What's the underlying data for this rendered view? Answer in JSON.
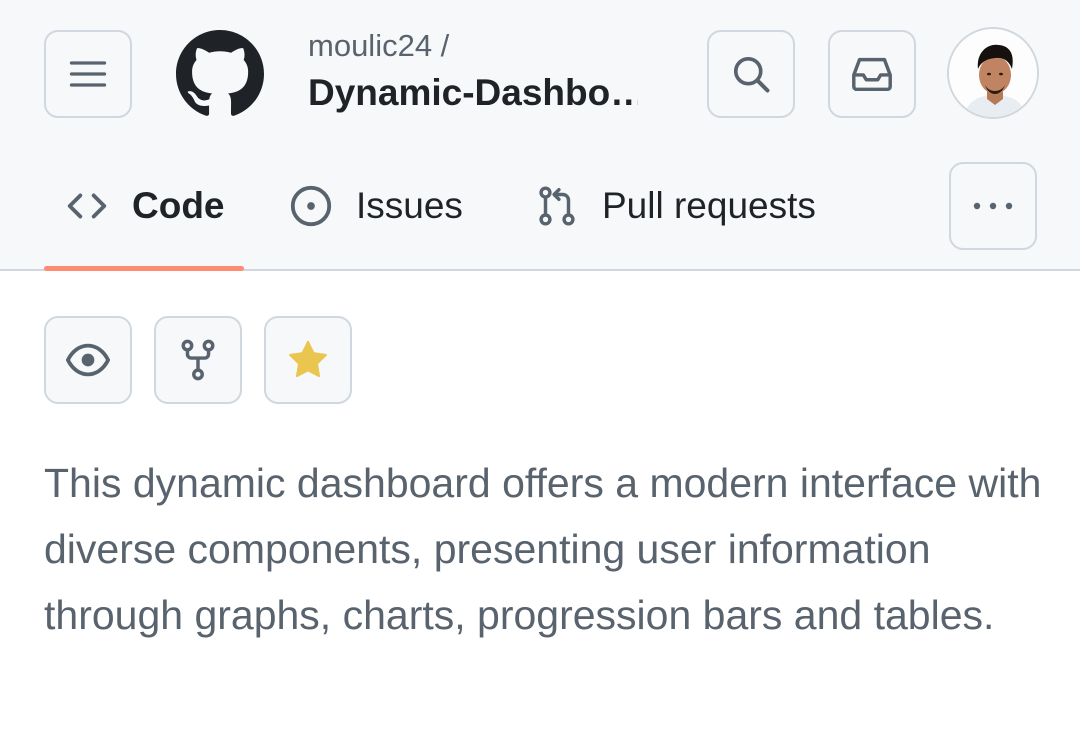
{
  "repo": {
    "owner_label": "moulic24 /",
    "name": "Dynamic-Dashbo…"
  },
  "tabs": [
    {
      "label": "Code",
      "icon": "code-icon",
      "selected": true
    },
    {
      "label": "Issues",
      "icon": "issue-opened-icon",
      "selected": false
    },
    {
      "label": "Pull requests",
      "icon": "git-pull-request-icon",
      "selected": false
    }
  ],
  "header_icons": [
    "hamburger-menu-icon",
    "github-logo-icon",
    "search-icon",
    "inbox-icon",
    "user-avatar",
    "kebab-horizontal-icon"
  ],
  "actions": [
    {
      "icon": "eye-icon"
    },
    {
      "icon": "repo-forked-icon"
    },
    {
      "icon": "star-fill-icon"
    }
  ],
  "description": "This dynamic dashboard offers a modern interface with diverse components, presenting user information through graphs, charts, progression bars and tables.",
  "colors": {
    "header_bg": "#f6f8fa",
    "border": "#d0d7de",
    "tab_underline": "#fd8c73",
    "star": "#eac54f",
    "muted_text": "#59636e",
    "text": "#1f2328"
  }
}
